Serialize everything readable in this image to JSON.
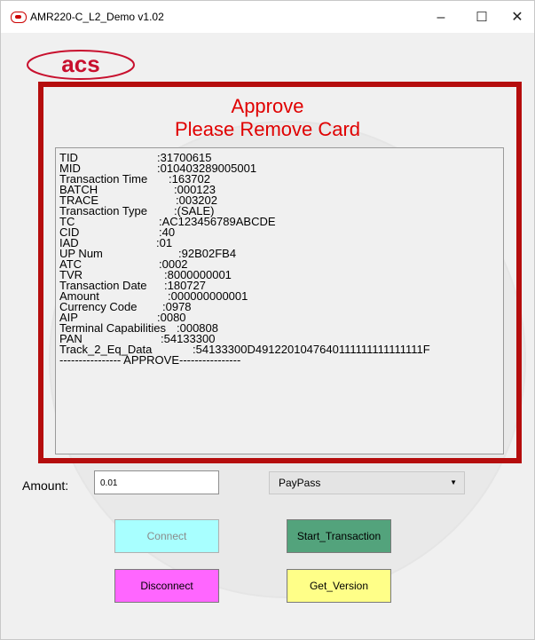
{
  "window": {
    "title": "AMR220-C_L2_Demo v1.02",
    "minimize_glyph": "–",
    "maximize_glyph": "☐",
    "close_glyph": "✕"
  },
  "logo": {
    "text": "acs",
    "color": "#c8102e"
  },
  "status": {
    "line1": "Approve",
    "line2": "Please Remove Card",
    "color": "#e00000"
  },
  "receipt": {
    "lines": [
      {
        "label": "TID",
        "value": ":31700615"
      },
      {
        "label": "MID",
        "value": ":010403289005001"
      },
      {
        "label": "Transaction Time",
        "value": ":163702"
      },
      {
        "label": "BATCH",
        "value": ":000123"
      },
      {
        "label": "TRACE",
        "value": ":003202"
      },
      {
        "label": "Transaction Type",
        "value": ":(SALE)"
      },
      {
        "label": "TC",
        "value": ":AC123456789ABCDE"
      },
      {
        "label": "CID",
        "value": ":40"
      },
      {
        "label": "IAD",
        "value": ":01"
      },
      {
        "label": "UP Num",
        "value": ":92B02FB4"
      },
      {
        "label": "ATC",
        "value": ":0002"
      },
      {
        "label": "TVR",
        "value": ":8000000001"
      },
      {
        "label": "Transaction Date",
        "value": ":180727"
      },
      {
        "label": "Amount",
        "value": ":000000000001"
      },
      {
        "label": "Currency Code",
        "value": ":0978"
      },
      {
        "label": "AIP",
        "value": ":0080"
      },
      {
        "label": "Terminal Capabilities",
        "value": ":000808"
      },
      {
        "label": "PAN",
        "value": ":54133300"
      },
      {
        "label": "Track_2_Eq_Data",
        "value": ":54133300D4912201047640111111111111111F"
      }
    ],
    "footer": "---------------- APPROVE----------------"
  },
  "form": {
    "amount_label": "Amount:",
    "amount_value": "0.01",
    "scheme_selected": "PayPass"
  },
  "buttons": {
    "connect": "Connect",
    "start_transaction": "Start_Transaction",
    "disconnect": "Disconnect",
    "get_version": "Get_Version"
  },
  "colors": {
    "frame_border": "#b50d0d",
    "connect_bg": "#a8ffff",
    "connect_text": "#8a8a8a",
    "start_bg": "#53a37c",
    "disconnect_bg": "#ff66ff",
    "get_version_bg": "#ffff88"
  }
}
